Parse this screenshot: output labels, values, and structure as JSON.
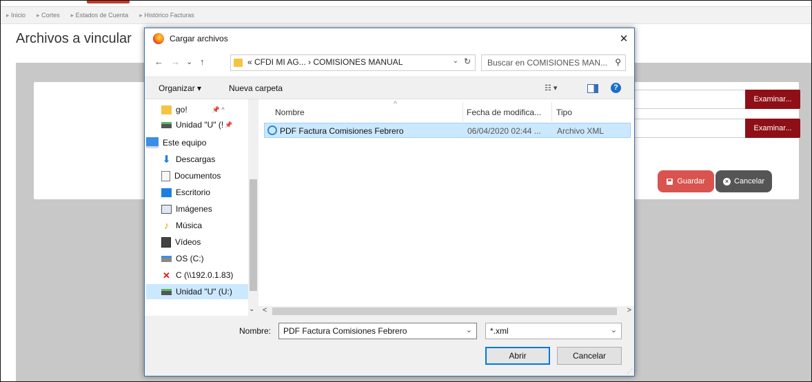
{
  "breadcrumbs": [
    "Inicio",
    "Cortes",
    "Estados de Cuenta",
    "Histórico Facturas"
  ],
  "page": {
    "title": "Archivos a vincular",
    "examinar_label": "Examinar...",
    "guardar_label": "Guardar",
    "cancelar_label": "Cancelar"
  },
  "dialog": {
    "title": "Cargar archivos",
    "close_glyph": "✕",
    "nav": {
      "back": "←",
      "forward": "→",
      "recent": "⌄",
      "up": "↑",
      "address": "« CFDI MI AG... › COMISIONES MANUAL",
      "address_dropdown": "⌄",
      "refresh": "↻",
      "search_placeholder": "Buscar en COMISIONES MAN...",
      "search_icon": "⚲"
    },
    "toolbar": {
      "organize": "Organizar ▾",
      "new_folder": "Nueva carpeta",
      "view_glyph": "☷ ▾",
      "help_glyph": "?"
    },
    "nav_pane": [
      {
        "label": "go!",
        "icon": "folder-icon",
        "pin": "📌 ^"
      },
      {
        "label": "Unidad \"U\" (!",
        "icon": "network-drive-icon",
        "pin": "📌"
      },
      {
        "label": "Este equipo",
        "icon": "computer-icon"
      },
      {
        "label": "Descargas",
        "icon": "downloads-icon"
      },
      {
        "label": "Documentos",
        "icon": "documents-icon"
      },
      {
        "label": "Escritorio",
        "icon": "desktop-icon"
      },
      {
        "label": "Imágenes",
        "icon": "pictures-icon"
      },
      {
        "label": "Música",
        "icon": "music-icon"
      },
      {
        "label": "Vídeos",
        "icon": "videos-icon"
      },
      {
        "label": "OS (C:)",
        "icon": "drive-icon"
      },
      {
        "label": "C (\\\\192.0.1.83)",
        "icon": "disconnected-drive-icon"
      },
      {
        "label": "Unidad \"U\" (U:)",
        "icon": "network-drive-icon"
      }
    ],
    "columns": {
      "name": "Nombre",
      "date": "Fecha de modifica...",
      "type": "Tipo",
      "sort_glyph": "^"
    },
    "files": [
      {
        "name": "PDF Factura Comisiones Febrero",
        "date": "06/04/2020 02:44 ...",
        "type": "Archivo XML",
        "icon": "ie-document-icon"
      }
    ],
    "scroll": {
      "left": "<",
      "right": ">",
      "down": "⌄"
    },
    "bottom": {
      "filename_label": "Nombre:",
      "filename_value": "PDF Factura Comisiones Febrero",
      "filter_value": "*.xml",
      "dropdown_glyph": "⌄",
      "open_label": "Abrir",
      "cancel_label": "Cancelar"
    }
  },
  "colors": {
    "examinar_bg": "#8e1016",
    "guardar_bg": "#d9534f",
    "cancelar_bg": "#555555",
    "selection": "#cce8ff",
    "dialog_border": "#3b6fa8"
  }
}
